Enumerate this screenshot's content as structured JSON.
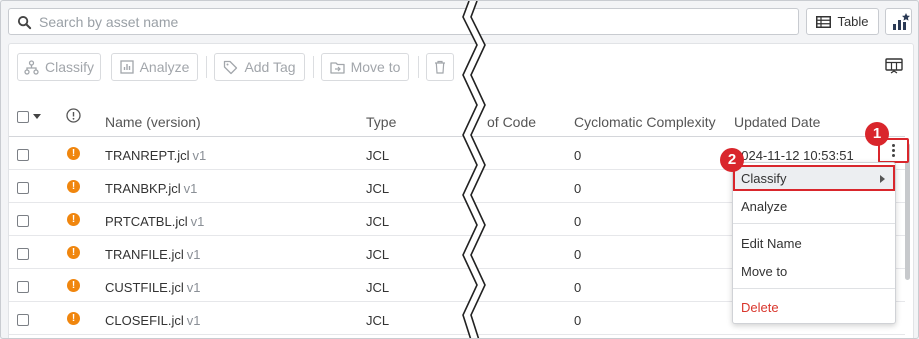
{
  "search": {
    "placeholder": "Search by asset name"
  },
  "view_toggle": {
    "label": "Table"
  },
  "toolbar": {
    "classify": "Classify",
    "analyze": "Analyze",
    "add_tag": "Add Tag",
    "move_to": "Move to"
  },
  "columns": {
    "name": "Name (version)",
    "type": "Type",
    "lines_of_code": "of Code",
    "cyclomatic": "Cyclomatic Complexity",
    "updated": "Updated Date"
  },
  "rows": [
    {
      "name": "TRANREPT.jcl",
      "version": "v1",
      "type": "JCL",
      "complexity": "0",
      "updated": "2024-11-12 10:53:51"
    },
    {
      "name": "TRANBKP.jcl",
      "version": "v1",
      "type": "JCL",
      "complexity": "0"
    },
    {
      "name": "PRTCATBL.jcl",
      "version": "v1",
      "type": "JCL",
      "complexity": "0"
    },
    {
      "name": "TRANFILE.jcl",
      "version": "v1",
      "type": "JCL",
      "complexity": "0"
    },
    {
      "name": "CUSTFILE.jcl",
      "version": "v1",
      "type": "JCL",
      "complexity": "0"
    },
    {
      "name": "CLOSEFIL.jcl",
      "version": "v1",
      "type": "JCL",
      "complexity": "0"
    }
  ],
  "context_menu": {
    "classify": "Classify",
    "analyze": "Analyze",
    "edit_name": "Edit Name",
    "move_to": "Move to",
    "delete": "Delete"
  },
  "callouts": {
    "one": "1",
    "two": "2"
  },
  "colors": {
    "warning": "#f0860e",
    "callout": "#d9262c",
    "danger": "#d9362c"
  }
}
